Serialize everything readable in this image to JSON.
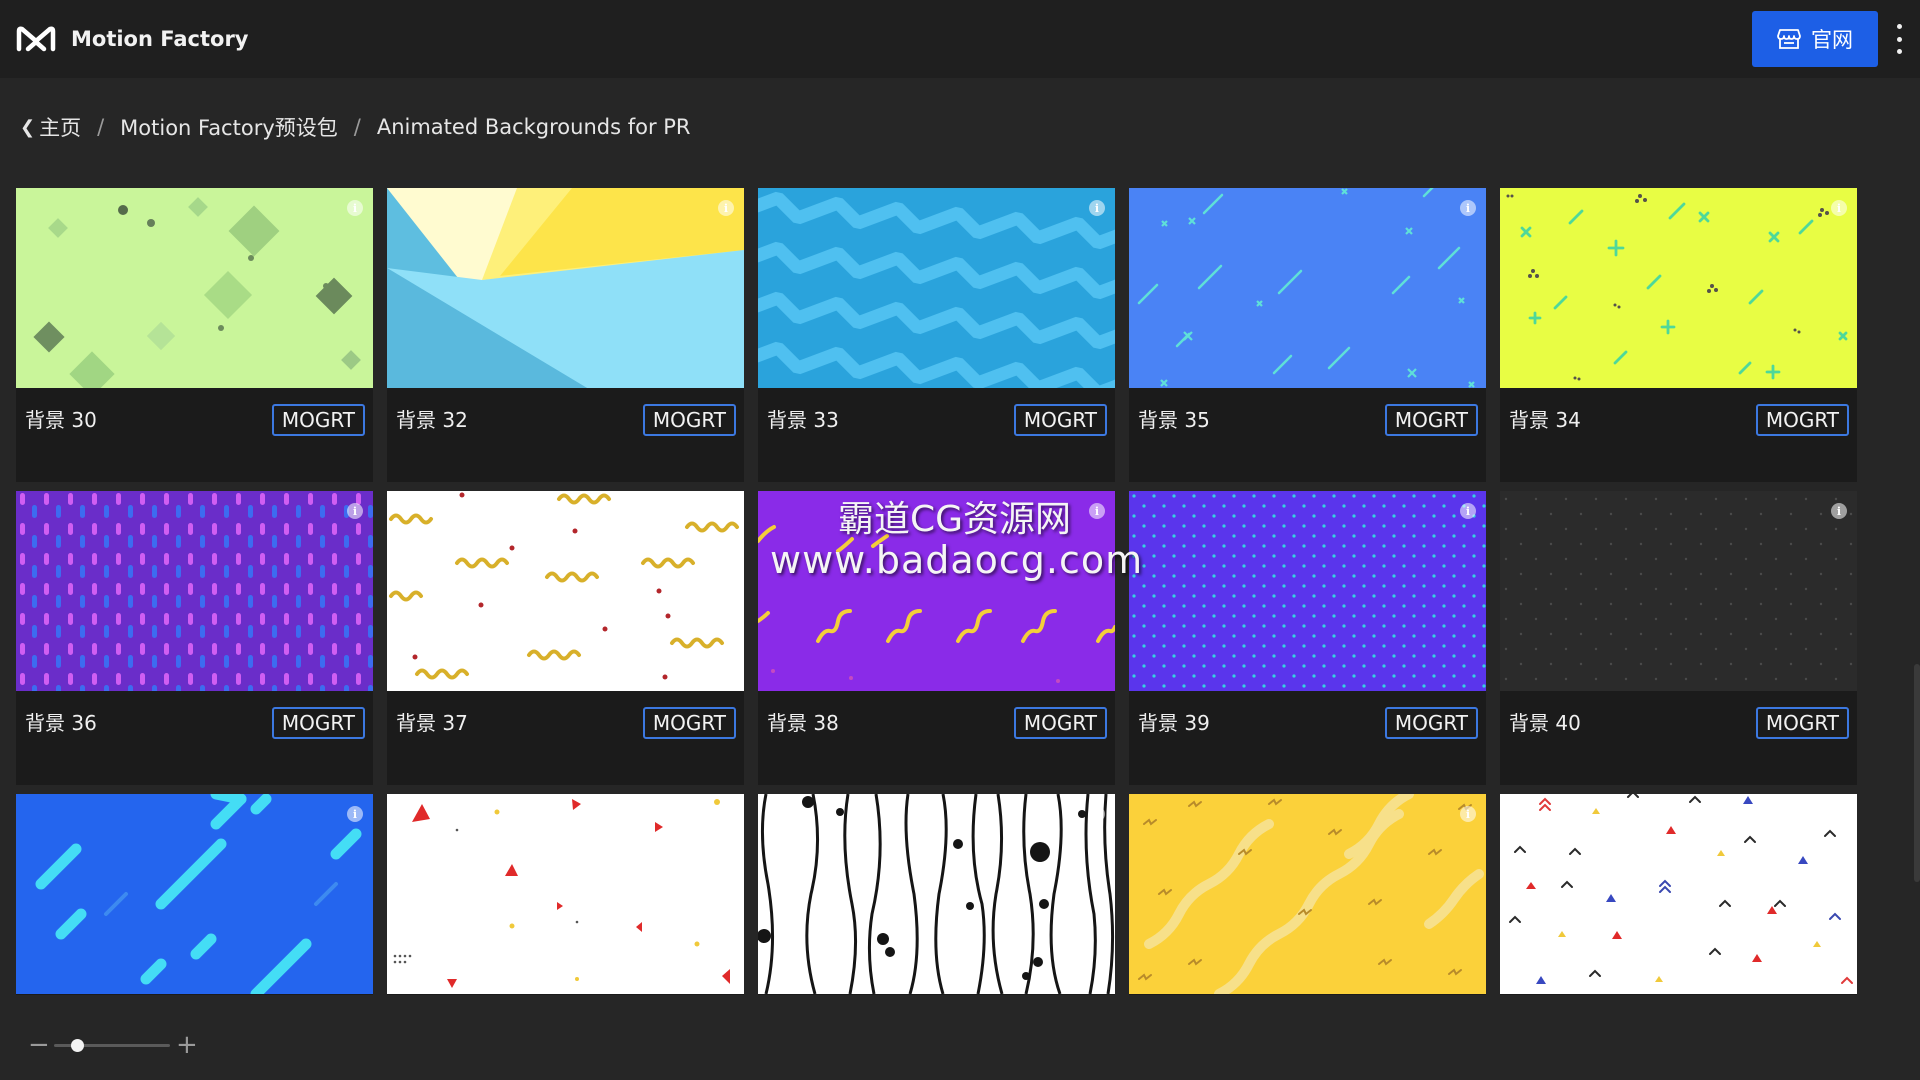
{
  "header": {
    "app_name": "Motion Factory",
    "site_button_label": "官网",
    "brand_color": "#1d5fe6"
  },
  "breadcrumb": {
    "items": [
      "主页",
      "Motion Factory预设包",
      "Animated Backgrounds for PR"
    ],
    "separator": "/"
  },
  "grid": {
    "badge_label": "MOGRT",
    "cards": [
      {
        "title": "背景 30",
        "thumb": "green-diamonds"
      },
      {
        "title": "背景 32",
        "thumb": "yellow-blue-triangles"
      },
      {
        "title": "背景 33",
        "thumb": "blue-zigzag"
      },
      {
        "title": "背景 35",
        "thumb": "blue-lines-crosses"
      },
      {
        "title": "背景 34",
        "thumb": "lime-crosses"
      },
      {
        "title": "背景 36",
        "thumb": "purple-dashes"
      },
      {
        "title": "背景 37",
        "thumb": "white-yellow-squiggles"
      },
      {
        "title": "背景 38",
        "thumb": "purple-yellow-squiggles"
      },
      {
        "title": "背景 39",
        "thumb": "indigo-dots"
      },
      {
        "title": "背景 40",
        "thumb": "dark-dots"
      },
      {
        "title": "",
        "thumb": "blue-cyan-streaks"
      },
      {
        "title": "",
        "thumb": "white-red-triangles"
      },
      {
        "title": "",
        "thumb": "black-white-lines"
      },
      {
        "title": "",
        "thumb": "yellow-waves"
      },
      {
        "title": "",
        "thumb": "white-chevrons"
      }
    ]
  },
  "watermark": {
    "line1": "霸道CG资源网",
    "line2": "www.badaocg.com"
  },
  "zoom": {
    "minus_label": "−",
    "plus_label": "+",
    "level": 0.2
  },
  "icons": {
    "logo": "motion-factory-logo",
    "site_button": "store-icon",
    "menu": "kebab-menu-icon",
    "info": "info-icon"
  }
}
